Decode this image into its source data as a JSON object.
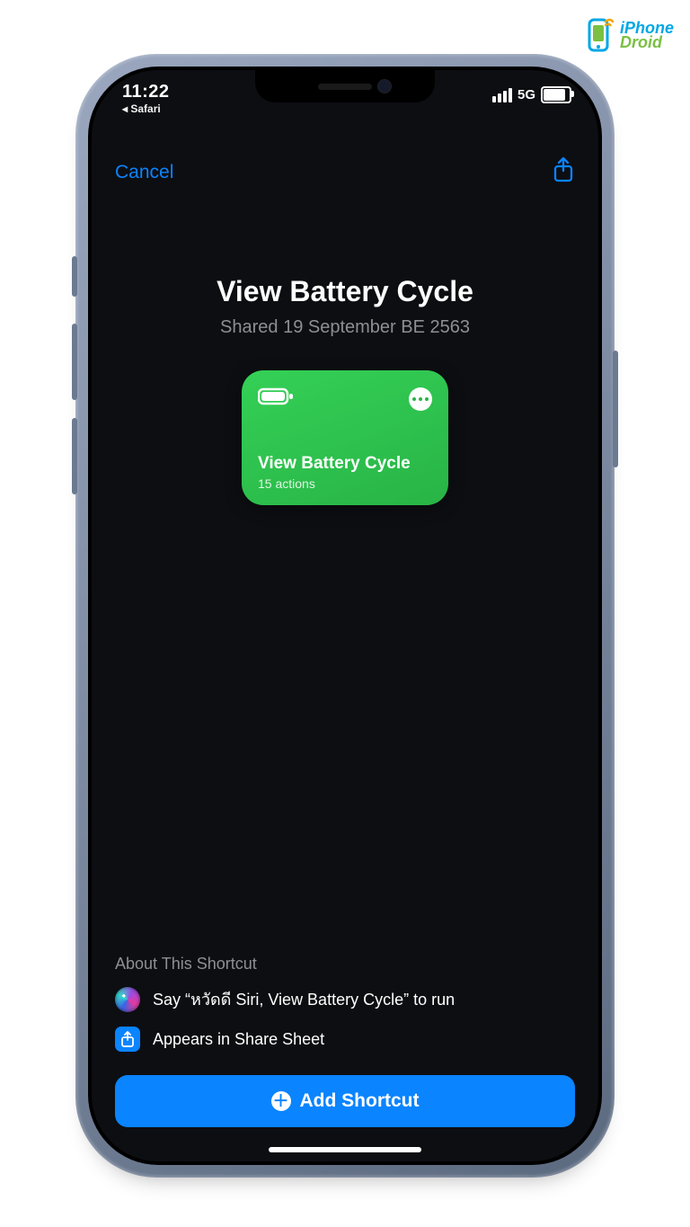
{
  "logo": {
    "line1": "iPhone",
    "line2": "Droid"
  },
  "status": {
    "time": "11:22",
    "back_app": "◂ Safari",
    "network": "5G"
  },
  "nav": {
    "cancel": "Cancel"
  },
  "page": {
    "title": "View Battery Cycle",
    "subtitle": "Shared 19 September BE 2563"
  },
  "card": {
    "title": "View Battery Cycle",
    "actions": "15 actions"
  },
  "about": {
    "heading": "About This Shortcut",
    "siri_hint": "Say “หวัดดี Siri, View Battery Cycle” to run",
    "share_sheet": "Appears in Share Sheet"
  },
  "cta": {
    "add": "Add Shortcut"
  }
}
